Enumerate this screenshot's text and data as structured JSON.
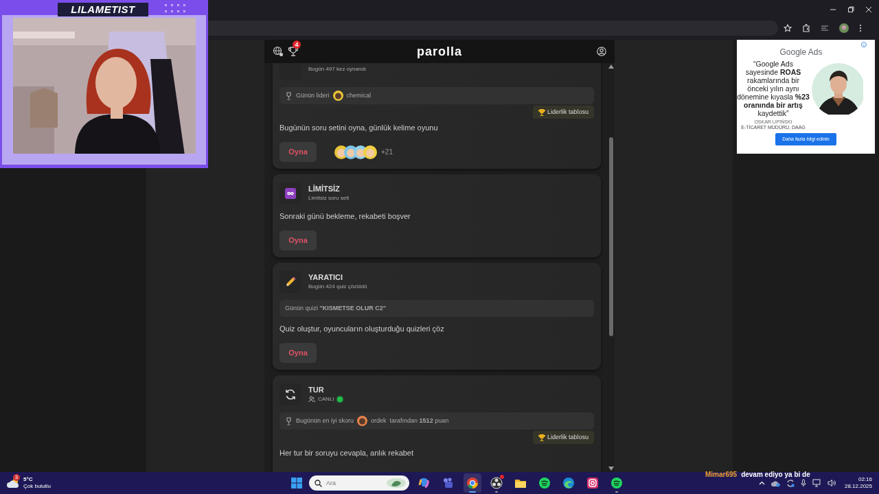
{
  "stream_overlay": {
    "channel_name": "LILAMETIST"
  },
  "app": {
    "title": "parolla",
    "notification_count": "4"
  },
  "cards": [
    {
      "subtitle": "Bugün 497 kez oynandı",
      "info": {
        "kind": "leader",
        "label": "Günün lideri",
        "user": "chemical"
      },
      "leaderboard": "Liderlik tablosu",
      "description": "Bugünün soru setini oyna, günlük kelime oyunu",
      "button": "Oyna",
      "avatars": [
        {
          "color": "#e8c43a"
        },
        {
          "color": "#7cc4e8"
        },
        {
          "color": "#8fd0ea"
        },
        {
          "color": "#f0d040"
        }
      ],
      "more": "+21"
    },
    {
      "kind": "infinity",
      "title": "LİMİTSİZ",
      "subtitle": "Limitsiz soru seti",
      "description": "Sonraki günü bekleme, rekabeti boşver",
      "button": "Oyna"
    },
    {
      "kind": "pencil",
      "title": "YARATICI",
      "subtitle": "Bugün 424 quiz çözüldü",
      "info": {
        "kind": "quiz",
        "text": "Günün quizi **\"KISMETSE OLUR C2\"**"
      },
      "description": "Quiz oluştur, oyuncuların oluşturduğu quizleri çöz",
      "button": "Oyna"
    },
    {
      "kind": "refresh",
      "title": "TUR",
      "subtitle": "CANLI",
      "live": true,
      "info": {
        "kind": "score",
        "label": "Bugünün en iyi skoru",
        "user": "ordek",
        "text": "tarafından **1512** puan"
      },
      "leaderboard": "Liderlik tablosu",
      "description": "Her tur bir soruyu cevapla, anlık rekabet"
    }
  ],
  "ad": {
    "logo": "Google Ads",
    "quote": "“Google Ads sayesinde **ROAS** rakamlarında bir önceki yılın aynı dönemine kıyasla **%23 oranında bir artış** kaydettik”",
    "person_name": "OSKAR LIPIŃSKI",
    "person_role": "E-TİCARET MÜDÜRÜ, DAAG",
    "button": "Daha fazla bilgi edinin"
  },
  "chat": {
    "user": "Mimar695",
    "message": "devam ediyo ya bi de"
  },
  "taskbar": {
    "weather": {
      "temp": "5°C",
      "condition": "Çok bulutlu",
      "badge": "3"
    },
    "search_placeholder": "Ara",
    "apps": [
      {
        "kind": "copilot",
        "running": false,
        "selected": false,
        "notification": false
      },
      {
        "kind": "teams",
        "running": false,
        "selected": false,
        "notification": false
      },
      {
        "kind": "chrome",
        "running": true,
        "selected": true,
        "notification": false
      },
      {
        "kind": "obs",
        "running": true,
        "selected": false,
        "notification": true
      },
      {
        "kind": "folder",
        "running": false,
        "selected": false,
        "notification": false
      },
      {
        "kind": "spotify",
        "running": false,
        "selected": false,
        "notification": false
      },
      {
        "kind": "edge",
        "running": false,
        "selected": false,
        "notification": false
      },
      {
        "kind": "instagram",
        "running": false,
        "selected": false,
        "notification": false
      },
      {
        "kind": "spotify",
        "running": true,
        "selected": false,
        "notification": false
      }
    ],
    "clock": {
      "time": "02:16",
      "date": "28.12.2025"
    }
  }
}
